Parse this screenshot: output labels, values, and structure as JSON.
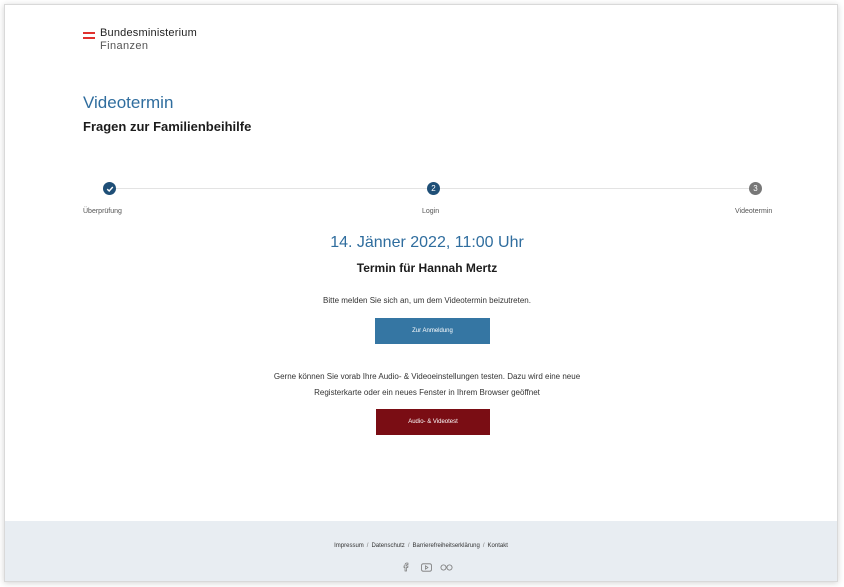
{
  "header": {
    "logo_line1": "Bundesministerium",
    "logo_line2": "Finanzen"
  },
  "page": {
    "title": "Videotermin",
    "subtitle": "Fragen zur Familienbeihilfe"
  },
  "stepper": {
    "steps": [
      {
        "label": "Überprüfung",
        "number": "",
        "state": "done"
      },
      {
        "label": "Login",
        "number": "2",
        "state": "active"
      },
      {
        "label": "Videotermin",
        "number": "3",
        "state": "pending"
      }
    ]
  },
  "appointment": {
    "date": "14. Jänner 2022, 11:00 Uhr",
    "for": "Termin für Hannah Mertz",
    "login_hint": "Bitte melden Sie sich an, um dem Videotermin beizutreten.",
    "login_button": "Zur Anmeldung",
    "test_hint_line1": "Gerne können Sie vorab Ihre Audio- & Videoeinstellungen testen. Dazu wird eine neue",
    "test_hint_line2": "Registerkarte oder ein neues Fenster in Ihrem Browser geöffnet",
    "test_button": "Audio- & Videotest"
  },
  "footer": {
    "links": [
      "Impressum",
      "Datenschutz",
      "Barrierefreiheitserklärung",
      "Kontakt"
    ],
    "separator": "/",
    "social_icons": [
      "facebook-icon",
      "youtube-icon",
      "flickr-icon"
    ]
  },
  "colors": {
    "accent_blue": "#2f6d9e",
    "step_active": "#1f4f77",
    "step_pending": "#777777",
    "login_button": "#3576a3",
    "test_button": "#7a0d14",
    "footer_bg": "#e8edf2",
    "flag_red": "#e0312e"
  }
}
